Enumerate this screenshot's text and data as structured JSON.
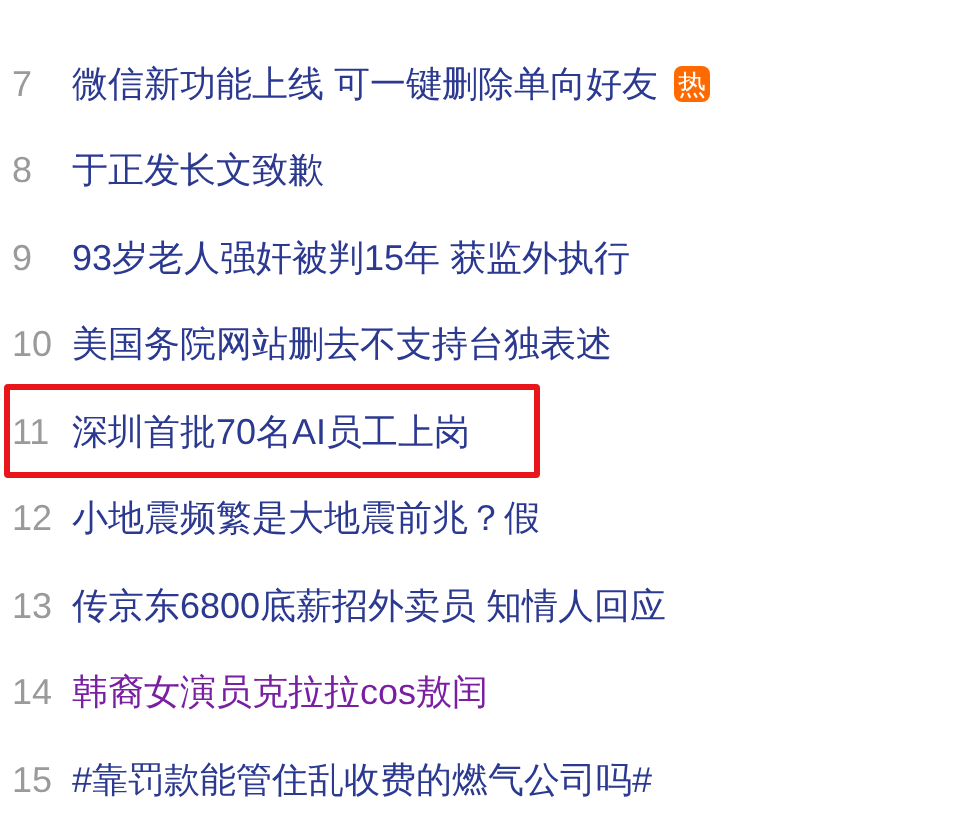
{
  "items": [
    {
      "rank": "7",
      "title": "微信新功能上线 可一键删除单向好友",
      "badge": "热",
      "visited": false,
      "highlighted": false
    },
    {
      "rank": "8",
      "title": "于正发长文致歉",
      "visited": false,
      "highlighted": false
    },
    {
      "rank": "9",
      "title": "93岁老人强奸被判15年 获监外执行",
      "visited": false,
      "highlighted": false
    },
    {
      "rank": "10",
      "title": "美国务院网站删去不支持台独表述",
      "visited": false,
      "highlighted": false
    },
    {
      "rank": "11",
      "title": "深圳首批70名AI员工上岗",
      "visited": false,
      "highlighted": true
    },
    {
      "rank": "12",
      "title": "小地震频繁是大地震前兆？假",
      "visited": false,
      "highlighted": false
    },
    {
      "rank": "13",
      "title": "传京东6800底薪招外卖员 知情人回应",
      "visited": false,
      "highlighted": false
    },
    {
      "rank": "14",
      "title": "韩裔女演员克拉拉cos敖闰",
      "visited": true,
      "highlighted": false
    },
    {
      "rank": "15",
      "title": "#靠罚款能管住乱收费的燃气公司吗#",
      "visited": false,
      "highlighted": false
    }
  ]
}
